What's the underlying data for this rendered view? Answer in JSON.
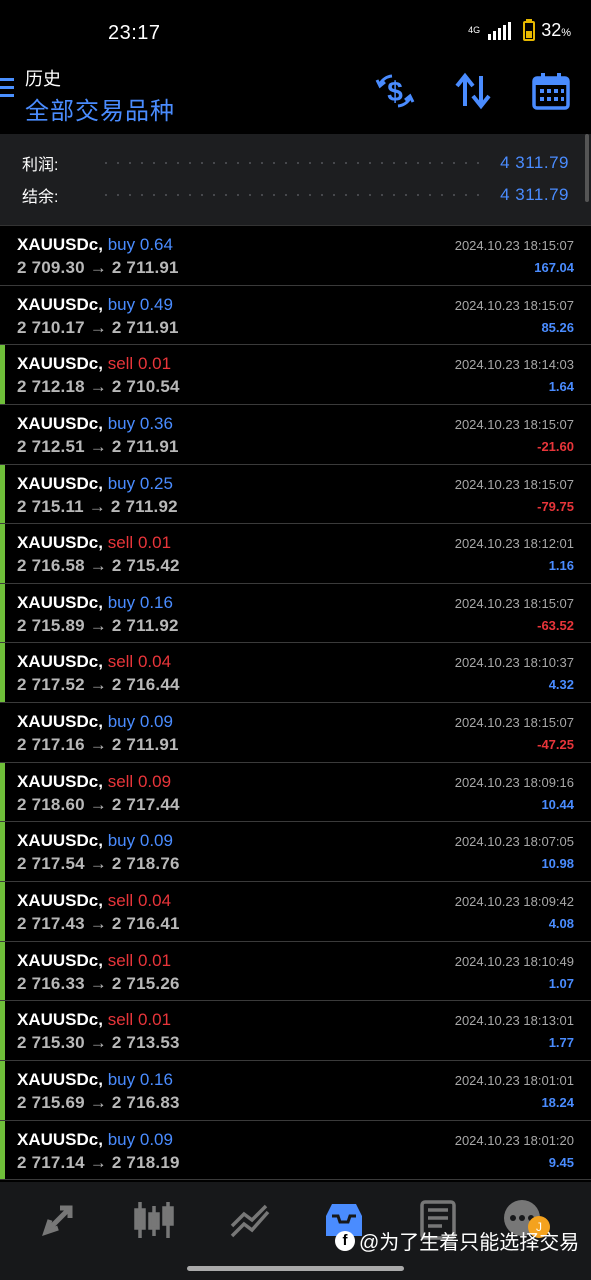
{
  "status": {
    "time": "23:17",
    "network": "4G",
    "battery": "32",
    "battery_unit": "%"
  },
  "header": {
    "subtitle": "历史",
    "title": "全部交易品种",
    "icons": [
      "currency-exchange-icon",
      "sort-arrows-icon",
      "calendar-icon"
    ]
  },
  "summary": {
    "profit_label": "利润:",
    "profit_value": "4 311.79",
    "balance_label": "结余:",
    "balance_value": "4 311.79"
  },
  "trades": [
    {
      "symbol": "XAUUSDc,",
      "side": "buy",
      "lots": "0.64",
      "open": "2 709.30",
      "close": "2 711.91",
      "time": "2024.10.23 18:15:07",
      "profit": "167.04",
      "bar": false
    },
    {
      "symbol": "XAUUSDc,",
      "side": "buy",
      "lots": "0.49",
      "open": "2 710.17",
      "close": "2 711.91",
      "time": "2024.10.23 18:15:07",
      "profit": "85.26",
      "bar": false
    },
    {
      "symbol": "XAUUSDc,",
      "side": "sell",
      "lots": "0.01",
      "open": "2 712.18",
      "close": "2 710.54",
      "time": "2024.10.23 18:14:03",
      "profit": "1.64",
      "bar": true
    },
    {
      "symbol": "XAUUSDc,",
      "side": "buy",
      "lots": "0.36",
      "open": "2 712.51",
      "close": "2 711.91",
      "time": "2024.10.23 18:15:07",
      "profit": "-21.60",
      "bar": false
    },
    {
      "symbol": "XAUUSDc,",
      "side": "buy",
      "lots": "0.25",
      "open": "2 715.11",
      "close": "2 711.92",
      "time": "2024.10.23 18:15:07",
      "profit": "-79.75",
      "bar": true
    },
    {
      "symbol": "XAUUSDc,",
      "side": "sell",
      "lots": "0.01",
      "open": "2 716.58",
      "close": "2 715.42",
      "time": "2024.10.23 18:12:01",
      "profit": "1.16",
      "bar": true
    },
    {
      "symbol": "XAUUSDc,",
      "side": "buy",
      "lots": "0.16",
      "open": "2 715.89",
      "close": "2 711.92",
      "time": "2024.10.23 18:15:07",
      "profit": "-63.52",
      "bar": true
    },
    {
      "symbol": "XAUUSDc,",
      "side": "sell",
      "lots": "0.04",
      "open": "2 717.52",
      "close": "2 716.44",
      "time": "2024.10.23 18:10:37",
      "profit": "4.32",
      "bar": true
    },
    {
      "symbol": "XAUUSDc,",
      "side": "buy",
      "lots": "0.09",
      "open": "2 717.16",
      "close": "2 711.91",
      "time": "2024.10.23 18:15:07",
      "profit": "-47.25",
      "bar": false
    },
    {
      "symbol": "XAUUSDc,",
      "side": "sell",
      "lots": "0.09",
      "open": "2 718.60",
      "close": "2 717.44",
      "time": "2024.10.23 18:09:16",
      "profit": "10.44",
      "bar": true
    },
    {
      "symbol": "XAUUSDc,",
      "side": "buy",
      "lots": "0.09",
      "open": "2 717.54",
      "close": "2 718.76",
      "time": "2024.10.23 18:07:05",
      "profit": "10.98",
      "bar": true
    },
    {
      "symbol": "XAUUSDc,",
      "side": "sell",
      "lots": "0.04",
      "open": "2 717.43",
      "close": "2 716.41",
      "time": "2024.10.23 18:09:42",
      "profit": "4.08",
      "bar": true
    },
    {
      "symbol": "XAUUSDc,",
      "side": "sell",
      "lots": "0.01",
      "open": "2 716.33",
      "close": "2 715.26",
      "time": "2024.10.23 18:10:49",
      "profit": "1.07",
      "bar": true
    },
    {
      "symbol": "XAUUSDc,",
      "side": "sell",
      "lots": "0.01",
      "open": "2 715.30",
      "close": "2 713.53",
      "time": "2024.10.23 18:13:01",
      "profit": "1.77",
      "bar": true
    },
    {
      "symbol": "XAUUSDc,",
      "side": "buy",
      "lots": "0.16",
      "open": "2 715.69",
      "close": "2 716.83",
      "time": "2024.10.23 18:01:01",
      "profit": "18.24",
      "bar": true
    },
    {
      "symbol": "XAUUSDc,",
      "side": "buy",
      "lots": "0.09",
      "open": "2 717.14",
      "close": "2 718.19",
      "time": "2024.10.23 18:01:20",
      "profit": "9.45",
      "bar": true
    }
  ],
  "price_arrow": "→",
  "bottom_nav": {
    "items": [
      "quotes-icon",
      "chart-candles-icon",
      "trade-icon",
      "history-icon",
      "news-icon",
      "chat-icon"
    ],
    "badge": "J",
    "watermark": "@为了生着只能选择交易"
  },
  "colors": {
    "buy": "#4a8cff",
    "sell": "#e8353a",
    "accent": "#4a8cff",
    "bar": "#6fbf3a"
  }
}
